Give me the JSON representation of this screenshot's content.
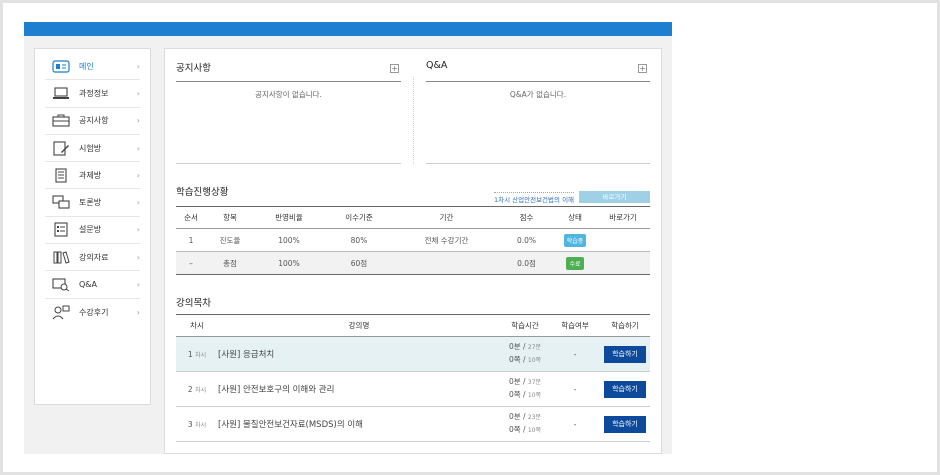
{
  "sidebar": {
    "items": [
      {
        "label": "메인",
        "icon": "main-icon",
        "active": true
      },
      {
        "label": "과정정보",
        "icon": "laptop-icon"
      },
      {
        "label": "공지사항",
        "icon": "bag-icon"
      },
      {
        "label": "시험방",
        "icon": "edit-icon"
      },
      {
        "label": "과제방",
        "icon": "document-icon"
      },
      {
        "label": "토론방",
        "icon": "chat-icon"
      },
      {
        "label": "설문방",
        "icon": "list-icon"
      },
      {
        "label": "강의자료",
        "icon": "books-icon"
      },
      {
        "label": "Q&A",
        "icon": "qa-icon"
      },
      {
        "label": "수강후기",
        "icon": "person-icon"
      }
    ],
    "chevron": "›"
  },
  "notice": {
    "title": "공지사항",
    "empty": "공지사항이 없습니다.",
    "plus": "+"
  },
  "qa": {
    "title": "Q&A",
    "empty": "Q&A가 없습니다.",
    "plus": "+"
  },
  "progress": {
    "title": "학습진행상황",
    "current_lesson": "1차시 산업안전보건법의 이해",
    "go_label": "바로가기",
    "headers": [
      "순서",
      "항목",
      "반영비율",
      "이수기준",
      "기간",
      "점수",
      "상태",
      "바로가기"
    ],
    "rows": [
      {
        "order": "1",
        "item": "진도율",
        "ratio": "100%",
        "criteria": "80%",
        "period": "전체 수강기간",
        "score": "0.0%",
        "status": "학습중",
        "status_color": "#4fb6e0"
      },
      {
        "order": "–",
        "item": "총점",
        "ratio": "100%",
        "criteria": "60점",
        "period": "",
        "score": "0.0점",
        "status": "수료",
        "status_color": "#4caf50"
      }
    ]
  },
  "lectures": {
    "title": "강의목차",
    "headers": [
      "차시",
      "강의명",
      "학습시간",
      "학습여부",
      "학습하기"
    ],
    "rows": [
      {
        "num": "1",
        "unit": "차시",
        "name": "[사원] 응급처치",
        "time_top": "0분 / ",
        "time_top_small": "27분",
        "time_bottom": "0쪽 / ",
        "time_bottom_small": "10쪽",
        "done": "-",
        "button": "학습하기"
      },
      {
        "num": "2",
        "unit": "차시",
        "name": "[사원] 안전보호구의 이해와 관리",
        "time_top": "0분 / ",
        "time_top_small": "37분",
        "time_bottom": "0쪽 / ",
        "time_bottom_small": "10쪽",
        "done": "-",
        "button": "학습하기"
      },
      {
        "num": "3",
        "unit": "차시",
        "name": "[사원] 물질안전보건자료(MSDS)의 이해",
        "time_top": "0분 / ",
        "time_top_small": "23분",
        "time_bottom": "0쪽 / ",
        "time_bottom_small": "10쪽",
        "done": "-",
        "button": "학습하기"
      }
    ]
  },
  "colors": {
    "topbar": "#1c7fcf",
    "active": "#1c7fcf",
    "button": "#0d4a9c",
    "highlight_row": "#e6f1f4"
  }
}
